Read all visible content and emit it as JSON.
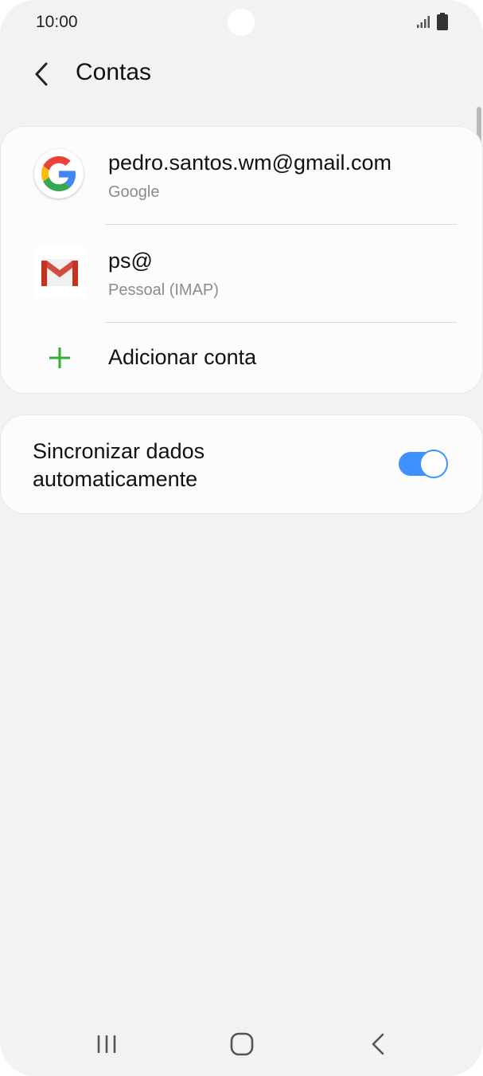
{
  "status_bar": {
    "time": "10:00",
    "signal_icon": "signal-icon",
    "battery_icon": "battery-icon"
  },
  "header": {
    "back_icon": "back-arrow-icon",
    "title": "Contas"
  },
  "accounts": [
    {
      "name": "pedro.santos.wm@gmail.com",
      "type": "Google",
      "icon": "google-icon"
    },
    {
      "name": "ps@",
      "type": "Pessoal (IMAP)",
      "icon": "gmail-icon"
    }
  ],
  "add_account": {
    "label": "Adicionar conta",
    "icon": "plus-icon"
  },
  "sync": {
    "label": "Sincronizar dados automaticamente",
    "enabled": true
  },
  "nav_bar": {
    "recents_icon": "recents-icon",
    "home_icon": "home-icon",
    "back_icon": "nav-back-icon"
  },
  "colors": {
    "accent_blue": "#3e91ff",
    "plus_green": "#2fb02f",
    "background": "#f2f2f2",
    "card": "#fcfcfc"
  }
}
